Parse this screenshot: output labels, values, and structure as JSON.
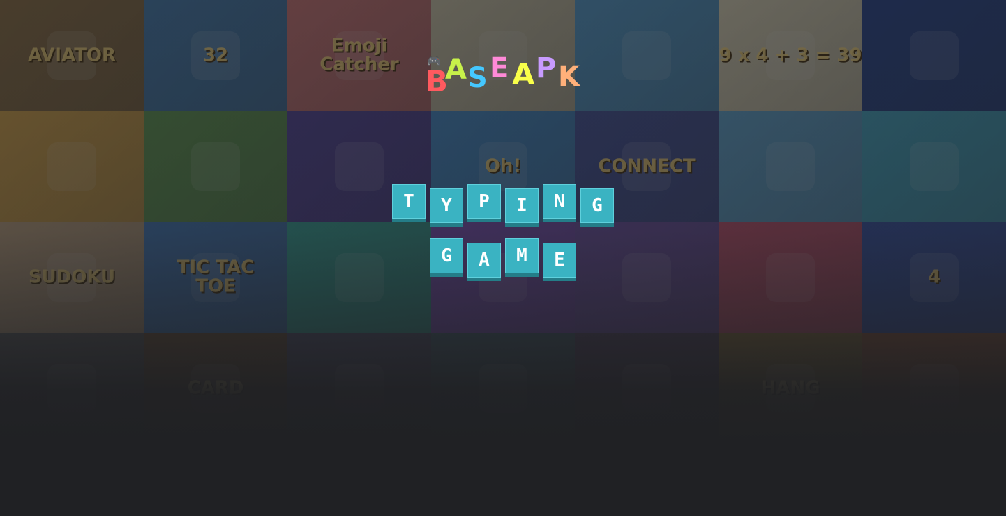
{
  "app": {
    "logo_letters": [
      "B",
      "A",
      "S",
      "E",
      "A",
      "P",
      "K"
    ],
    "logo_colors": [
      "#ff5a5f",
      "#c8f24a",
      "#45c8ff",
      "#ff8ad8",
      "#f9ff4a",
      "#c89bff",
      "#ffb07a"
    ],
    "title_line1": [
      "T",
      "Y",
      "P",
      "I",
      "N",
      "G"
    ],
    "title_line2": [
      "G",
      "A",
      "M",
      "E"
    ],
    "tile_color": "#3ab3c2",
    "background_color": "#202124"
  },
  "background_tiles": [
    {
      "label": "AVIATOR",
      "color": "#8a6a3a"
    },
    {
      "label": "32",
      "color": "#3a78b0"
    },
    {
      "label": "Emoji\nCatcher",
      "color": "#d07070"
    },
    {
      "label": "",
      "color": "#d0c8a8"
    },
    {
      "label": "",
      "color": "#4a9ad0"
    },
    {
      "label": "9 x 4 + 3 = 39",
      "color": "#e0d8b8"
    },
    {
      "label": "",
      "color": "#1a3a8a"
    },
    {
      "label": "",
      "color": "#e0a840"
    },
    {
      "label": "",
      "color": "#5a9a4a"
    },
    {
      "label": "",
      "color": "#4a3a9a"
    },
    {
      "label": "Oh!",
      "color": "#3a8ad0"
    },
    {
      "label": "CONNECT",
      "color": "#3a4a9a"
    },
    {
      "label": "",
      "color": "#5aa8d8"
    },
    {
      "label": "",
      "color": "#3aa8c8"
    },
    {
      "label": "SUDOKU",
      "color": "#c8a880"
    },
    {
      "label": "TIC TAC\nTOE",
      "color": "#3a78c0"
    },
    {
      "label": "",
      "color": "#2aa89a"
    },
    {
      "label": "",
      "color": "#7a4ac0"
    },
    {
      "label": "",
      "color": "#6a4aa8"
    },
    {
      "label": "",
      "color": "#c84a6a"
    },
    {
      "label": "4",
      "color": "#2a4aa8"
    },
    {
      "label": "",
      "color": "#5a5a5a"
    },
    {
      "label": "CARD",
      "color": "#6a4a2a"
    },
    {
      "label": "",
      "color": "#4a4a6a"
    },
    {
      "label": "",
      "color": "#3a5a6a"
    },
    {
      "label": "",
      "color": "#4a3a5a"
    },
    {
      "label": "HANG",
      "color": "#8a6a2a"
    },
    {
      "label": "",
      "color": "#8a4a2a"
    }
  ]
}
